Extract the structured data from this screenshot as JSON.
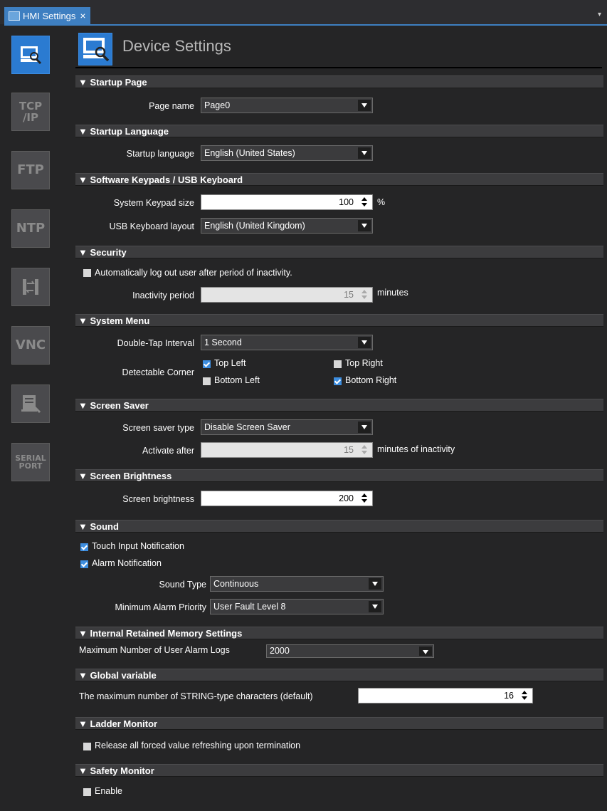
{
  "tab": {
    "title": "HMI Settings",
    "close": "×",
    "menu": "▾"
  },
  "sidebar": {
    "items": [
      {
        "label": "",
        "icon": "device-settings-icon"
      },
      {
        "label1": "TCP",
        "label2": "/IP"
      },
      {
        "label": "FTP"
      },
      {
        "label": "NTP"
      },
      {
        "label": "",
        "icon": "sync-icon"
      },
      {
        "label": "VNC"
      },
      {
        "label": "",
        "icon": "terminal-icon"
      },
      {
        "label1": "SERIAL",
        "label2": "PORT"
      }
    ]
  },
  "header": {
    "title": "Device Settings"
  },
  "sections": {
    "startup_page": {
      "title": "▼ Startup Page",
      "page_name_label": "Page name",
      "page_name_value": "Page0"
    },
    "startup_language": {
      "title": "▼ Startup Language",
      "label": "Startup language",
      "value": "English (United States)"
    },
    "keypads": {
      "title": "▼ Software Keypads / USB Keyboard",
      "keypad_size_label": "System Keypad size",
      "keypad_size_value": "100",
      "keypad_size_unit": "%",
      "usb_layout_label": "USB Keyboard layout",
      "usb_layout_value": "English (United Kingdom)"
    },
    "security": {
      "title": "▼ Security",
      "auto_logout_label": "Automatically log out user after period of inactivity.",
      "auto_logout_checked": false,
      "inactivity_label": "Inactivity period",
      "inactivity_value": "15",
      "inactivity_unit": "minutes"
    },
    "system_menu": {
      "title": "▼ System Menu",
      "double_tap_label": "Double-Tap Interval",
      "double_tap_value": "1 Second",
      "corner_label": "Detectable Corner",
      "top_left": "Top Left",
      "top_right": "Top Right",
      "bottom_left": "Bottom Left",
      "bottom_right": "Bottom Right",
      "top_left_checked": true,
      "top_right_checked": false,
      "bottom_left_checked": false,
      "bottom_right_checked": true
    },
    "screen_saver": {
      "title": "▼ Screen Saver",
      "type_label": "Screen saver type",
      "type_value": "Disable Screen Saver",
      "activate_label": "Activate after",
      "activate_value": "15",
      "activate_unit": "minutes of inactivity"
    },
    "brightness": {
      "title": "▼ Screen Brightness",
      "label": "Screen brightness",
      "value": "200"
    },
    "sound": {
      "title": "▼ Sound",
      "touch_label": "Touch Input Notification",
      "touch_checked": true,
      "alarm_label": "Alarm Notification",
      "alarm_checked": true,
      "sound_type_label": "Sound Type",
      "sound_type_value": "Continuous",
      "min_priority_label": "Minimum Alarm Priority",
      "min_priority_value": "User Fault Level 8"
    },
    "retained_memory": {
      "title": "▼ Internal Retained Memory Settings",
      "max_logs_label": "Maximum Number of User Alarm Logs",
      "max_logs_value": "2000"
    },
    "global_variable": {
      "title": "▼ Global variable",
      "max_string_label": "The maximum number of STRING-type characters (default)",
      "max_string_value": "16"
    },
    "ladder_monitor": {
      "title": "▼ Ladder Monitor",
      "release_label": "Release all forced value refreshing upon termination",
      "release_checked": false
    },
    "safety_monitor": {
      "title": "▼ Safety Monitor",
      "enable_label": "Enable",
      "enable_checked": false
    }
  }
}
